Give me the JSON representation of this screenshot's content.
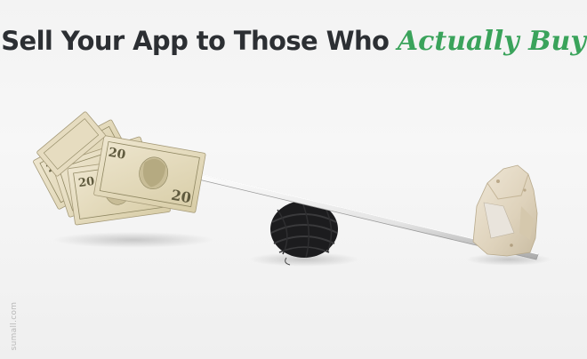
{
  "headline": {
    "lead": "Sell Your App to Those Who ",
    "accent": "Actually Buy"
  },
  "watermark": "sumall.com",
  "colors": {
    "accent": "#3aa35b",
    "text": "#2c2f33",
    "background": "#f4f4f4"
  },
  "illustration": {
    "bills_denomination": "20"
  }
}
